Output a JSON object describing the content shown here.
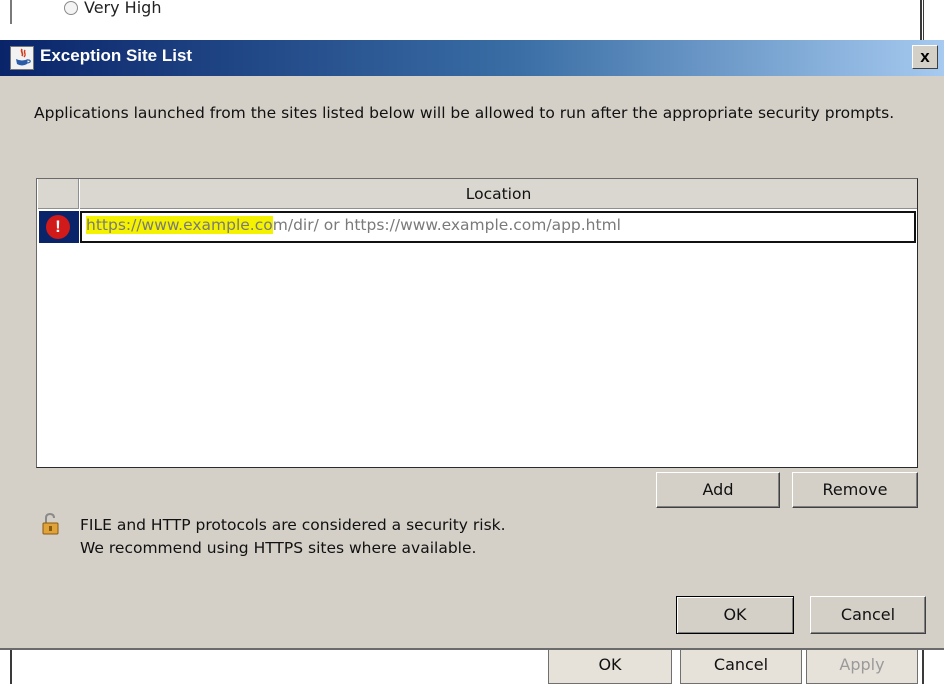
{
  "background_window": {
    "radio_label": "Very High",
    "buttons": [
      {
        "label": "OK",
        "enabled": true
      },
      {
        "label": "Cancel",
        "enabled": true
      },
      {
        "label": "Apply",
        "enabled": false
      }
    ]
  },
  "dialog": {
    "title": "Exception Site List",
    "close_glyph": "x",
    "title_icon": "java-icon",
    "description": "Applications launched from the sites listed below will be allowed to run after the appropriate security prompts.",
    "table": {
      "columns": [
        "",
        "Location"
      ],
      "rows": [
        {
          "status_icon": "error-icon",
          "status_glyph": "!",
          "url_highlighted": "https://www.example.co",
          "url_rest": "m/dir/ or https://www.example.com/app.html"
        }
      ]
    },
    "add_label": "Add",
    "remove_label": "Remove",
    "warning_icon": "unlocked-padlock-icon",
    "warning_line1": "FILE and HTTP protocols are considered a security risk.",
    "warning_line2": "We recommend using HTTPS sites where available.",
    "ok_label": "OK",
    "cancel_label": "Cancel"
  },
  "colors": {
    "highlight": "#f5f200",
    "title_start": "#0a246a",
    "title_end": "#a6caf0",
    "dialog_bg": "#d4d0c8",
    "error": "#d11a1a"
  }
}
